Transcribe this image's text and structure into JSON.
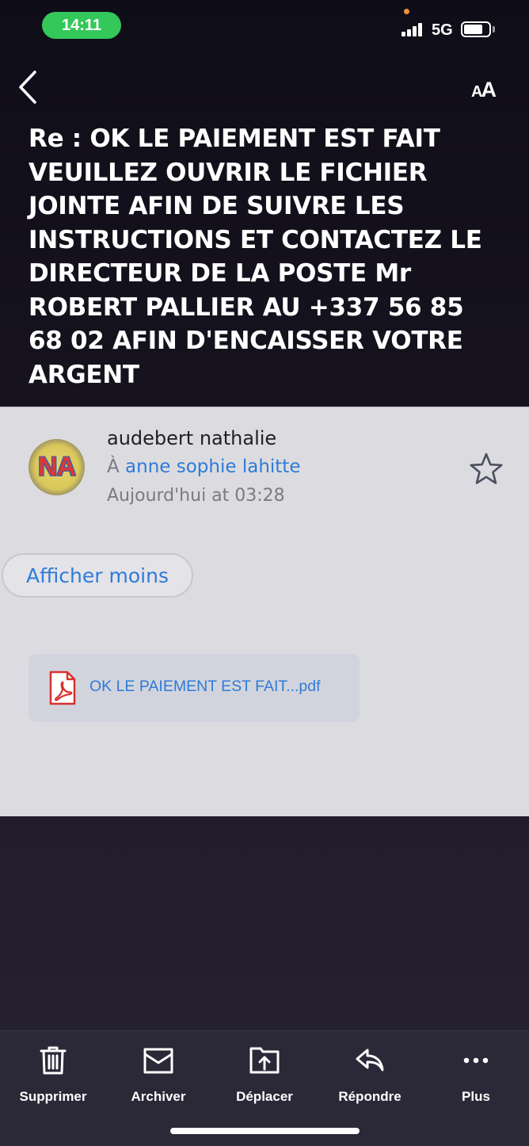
{
  "status_bar": {
    "time": "14:11",
    "network": "5G",
    "battery_level": 0.75
  },
  "header": {
    "text_size_label_small": "A",
    "text_size_label_big": "A"
  },
  "email": {
    "subject": "Re : OK LE PAIEMENT EST FAIT VEUILLEZ OUVRIR LE FICHIER JOINTE AFIN DE SUIVRE LES INSTRUCTIONS ET CONTACTEZ LE DIRECTEUR DE LA POSTE Mr ROBERT PALLIER AU +337 56 85 68 02 AFIN D'ENCAISSER VOTRE ARGENT",
    "sender": {
      "name": "audebert nathalie",
      "avatar_initials": "NA"
    },
    "recipient_prefix": "À",
    "recipient": "anne sophie lahitte",
    "date": "Aujourd'hui at 03:28",
    "show_less_label": "Afficher moins",
    "attachment": {
      "name": "OK LE PAIEMENT EST FAIT...pdf",
      "icon": "pdf-icon"
    }
  },
  "toolbar": {
    "items": [
      {
        "label": "Supprimer",
        "icon": "trash-icon"
      },
      {
        "label": "Archiver",
        "icon": "archive-icon"
      },
      {
        "label": "Déplacer",
        "icon": "move-icon"
      },
      {
        "label": "Répondre",
        "icon": "reply-icon"
      },
      {
        "label": "Plus",
        "icon": "more-icon"
      }
    ]
  },
  "colors": {
    "accent": "#2e7bd8",
    "time_pill": "#34c759",
    "pdf_red": "#d6302f"
  }
}
